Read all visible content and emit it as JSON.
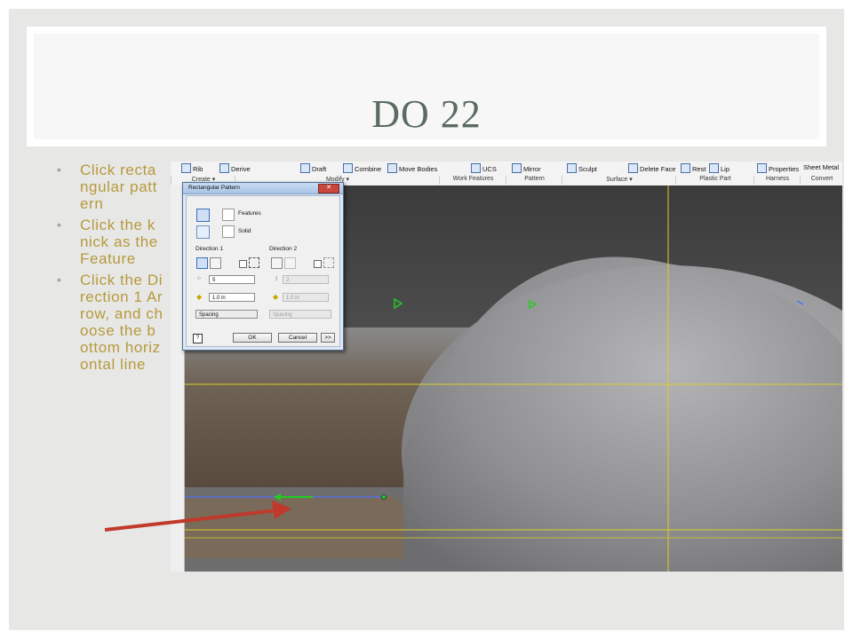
{
  "slide": {
    "title": "DO 22",
    "bullets": [
      "Click rectangular pattern",
      "Click the knick as the Feature",
      "Click the Direction 1 Arrow, and choose the bottom horizontal line"
    ]
  },
  "ribbon": {
    "items": [
      "Rib",
      "Derive",
      "Draft",
      "Combine",
      "Move Bodies",
      "UCS",
      "Mirror",
      "Sculpt",
      "Delete Face",
      "Rest",
      "Lip",
      "Properties",
      "Sheet Metal"
    ],
    "groups": [
      "Create ▾",
      "Modify ▾",
      "Work Features",
      "Pattern",
      "Surface ▾",
      "Plastic Part",
      "Harness",
      "Convert"
    ]
  },
  "dialog": {
    "title": "Rectangular Pattern",
    "close_label": "✕",
    "features_label": "Features",
    "solid_label": "Solid",
    "direction1_label": "Direction 1",
    "direction2_label": "Direction 2",
    "count1_value": "5",
    "spacing1_value": "1.0 in",
    "count2_value": "2",
    "spacing2_value": "1.0 in",
    "method1_value": "Spacing",
    "method2_value": "Spacing",
    "ok_label": "OK",
    "cancel_label": "Cancel",
    "more_label": ">>"
  },
  "colors": {
    "title": "#5a6b5f",
    "bullet_text": "#b69a3c",
    "annotation_arrow": "#c0392b",
    "guide_lines": "#d8cf2a",
    "preview_arrows": "#22cc22"
  }
}
